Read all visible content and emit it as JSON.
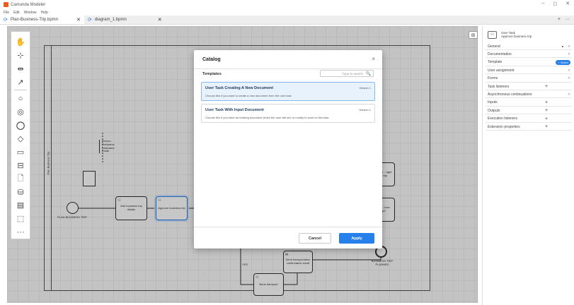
{
  "app": {
    "title": "Camunda Modeler"
  },
  "menu": [
    "File",
    "Edit",
    "Window",
    "Help"
  ],
  "window_controls": [
    "–",
    "◻",
    "✕"
  ],
  "tabs": [
    {
      "label": "Plan-Business-Trip.bpmn",
      "close": "✕"
    },
    {
      "label": "diagram_1.bpmn",
      "close": "✕"
    }
  ],
  "tabbar_actions": [
    "+",
    "···"
  ],
  "canvas": {
    "pool_label": "Plan Business Trip",
    "data_object_label": "Person\nFirstname\nLastname\nEmail",
    "start_label": "PLAN BUSINESS TRIP",
    "end_label": "BUSINESS TRIP PLANNED",
    "tasks": [
      {
        "label": "Add business trip details"
      },
      {
        "label": "Approve business trip"
      },
      {
        "label": "Send transportation confirmation email"
      },
      {
        "label": "Book transport"
      },
      {
        "label": "...ment to ...dget ...ess trip"
      },
      {
        "label": "...ager ...rove ...dget"
      }
    ],
    "flow_label": "YES"
  },
  "catalog": {
    "title": "Catalog",
    "close": "×",
    "templates_heading": "Templates",
    "search_placeholder": "Type to search",
    "items": [
      {
        "title": "User Task Creating A New Document",
        "version": "Version 1",
        "description": "Choose this if you want to create a new document from the user task",
        "selected": true
      },
      {
        "title": "User Task With Input Document",
        "version": "Version 1",
        "description": "Choose this if you have an existing document which the user will see or modify to work on this task",
        "selected": false
      }
    ],
    "cancel_label": "Cancel",
    "apply_label": "Apply"
  },
  "properties": {
    "element_type": "User Task",
    "element_name": "Approve business trip",
    "rows": [
      {
        "label": "General",
        "kind": "chevron",
        "dot": true
      },
      {
        "label": "Documentation",
        "kind": "chevron"
      },
      {
        "label": "Template",
        "kind": "select",
        "button": "+ Select"
      },
      {
        "label": "User assignment",
        "kind": "chevron"
      },
      {
        "label": "Forms",
        "kind": "chevron"
      },
      {
        "label": "Task listeners",
        "kind": "plus"
      },
      {
        "label": "Asynchronous continuations",
        "kind": "chevron"
      },
      {
        "label": "Inputs",
        "kind": "plus"
      },
      {
        "label": "Outputs",
        "kind": "plus"
      },
      {
        "label": "Execution listeners",
        "kind": "plus"
      },
      {
        "label": "Extension properties",
        "kind": "plus"
      }
    ]
  },
  "colors": {
    "accent": "#2680eb",
    "brand": "#f05a1e",
    "selected_card": "#e8f2fc"
  }
}
